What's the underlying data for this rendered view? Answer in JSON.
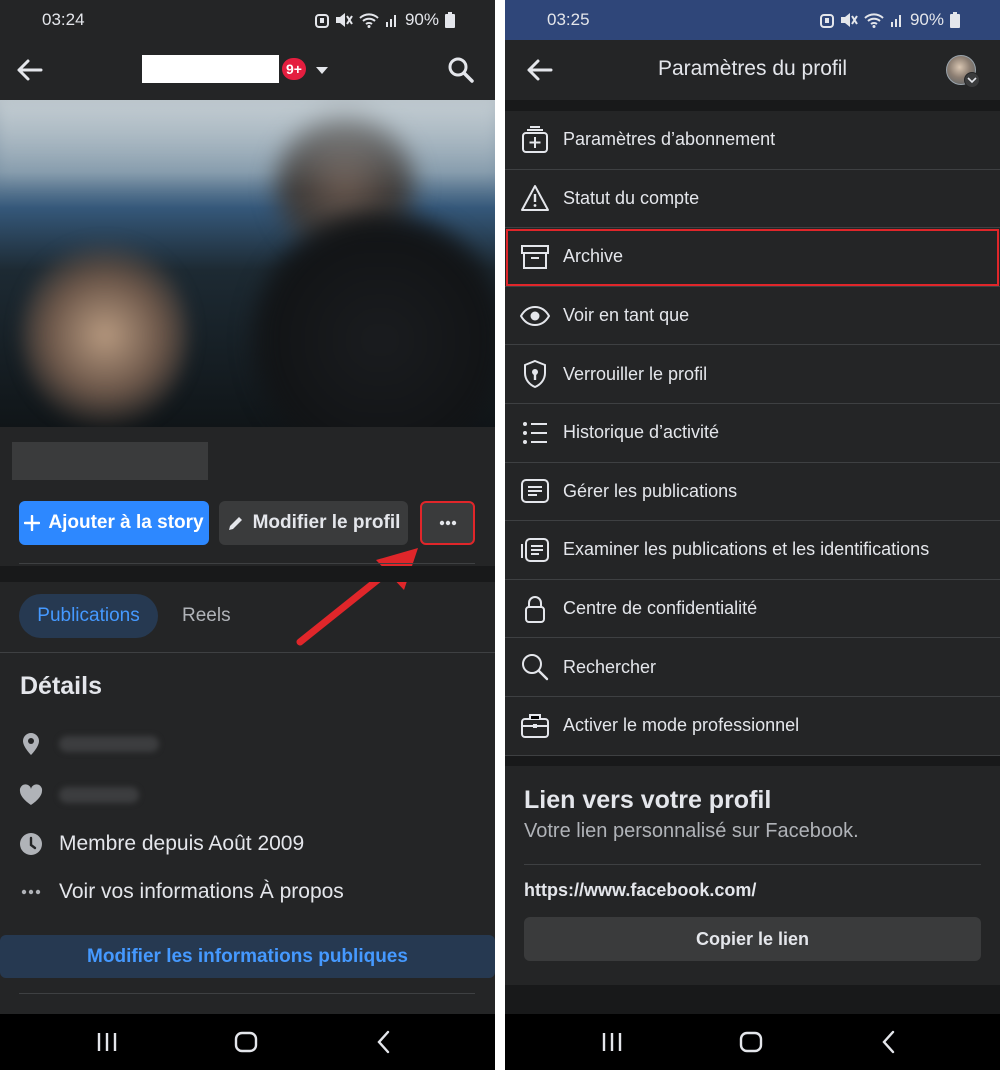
{
  "left": {
    "status": {
      "time": "03:24",
      "battery": "90%"
    },
    "header": {
      "badge": "9+"
    },
    "buttons": {
      "add_story": "Ajouter à la story",
      "edit_profile": "Modifier le profil",
      "more": "···"
    },
    "tabs": [
      {
        "label": "Publications",
        "active": true
      },
      {
        "label": "Reels",
        "active": false
      }
    ],
    "details": {
      "title": "Détails",
      "member_since": "Membre depuis Août 2009",
      "see_about": "Voir vos informations À propos"
    },
    "edit_public_info": "Modifier les informations publiques"
  },
  "right": {
    "status": {
      "time": "03:25",
      "battery": "90%"
    },
    "title": "Paramètres du profil",
    "menu": [
      {
        "label": "Paramètres d’abonnement",
        "icon": "subscription-icon"
      },
      {
        "label": "Statut du compte",
        "icon": "warning-icon"
      },
      {
        "label": "Archive",
        "icon": "archive-icon",
        "highlighted": true
      },
      {
        "label": "Voir en tant que",
        "icon": "eye-icon"
      },
      {
        "label": "Verrouiller le profil",
        "icon": "shield-lock-icon"
      },
      {
        "label": "Historique d’activité",
        "icon": "list-icon"
      },
      {
        "label": "Gérer les publications",
        "icon": "posts-icon"
      },
      {
        "label": "Examiner les publications et les identifications",
        "icon": "review-icon"
      },
      {
        "label": "Centre de confidentialité",
        "icon": "lock-icon"
      },
      {
        "label": "Rechercher",
        "icon": "search-icon"
      },
      {
        "label": "Activer le mode professionnel",
        "icon": "briefcase-icon"
      }
    ],
    "profile_link": {
      "title": "Lien vers votre profil",
      "subtitle": "Votre lien personnalisé sur Facebook.",
      "url": "https://www.facebook.com/",
      "copy_button": "Copier le lien"
    }
  },
  "colors": {
    "background": "#242526",
    "accent_blue": "#2d88ff",
    "highlight_red": "#e0262a",
    "right_status_bar": "#2f4679"
  }
}
